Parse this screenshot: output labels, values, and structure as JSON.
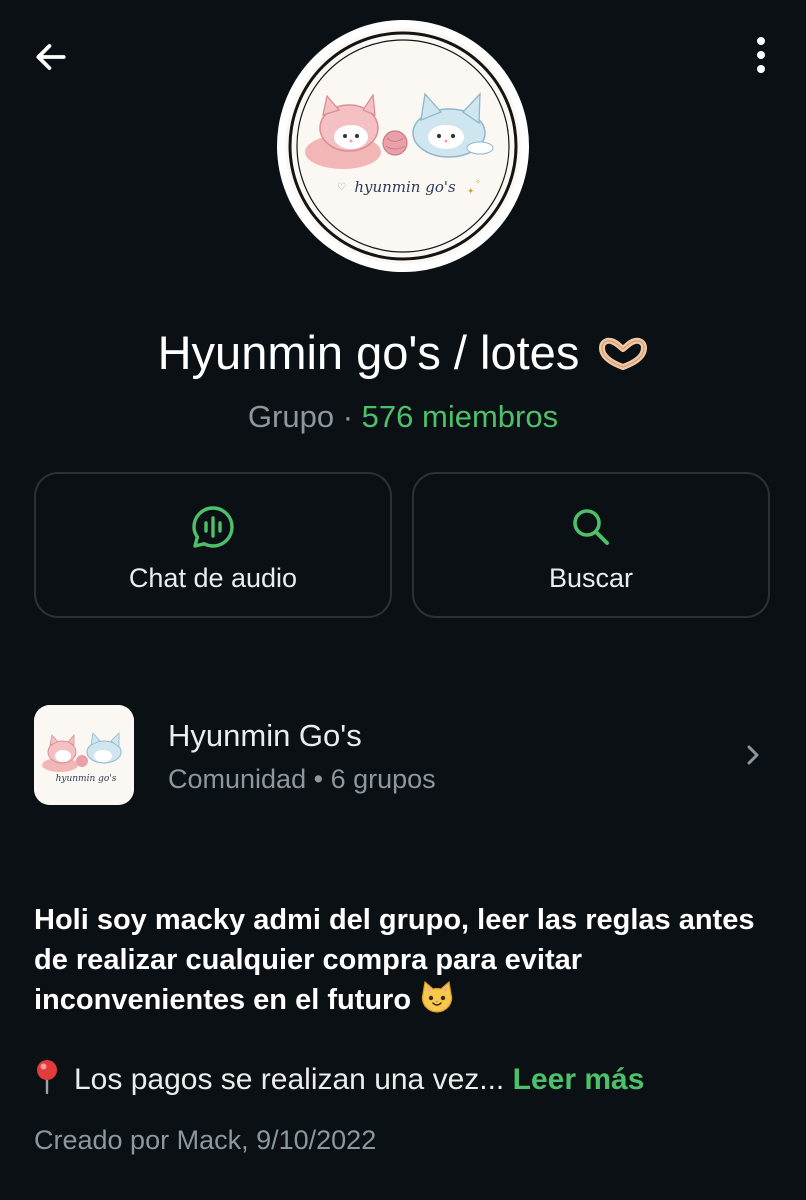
{
  "header": {
    "back_icon": "arrow-left-icon",
    "menu_icon": "more-vertical-icon"
  },
  "group": {
    "avatar_logo_text": "hyunmin go's",
    "title": "Hyunmin go's / lotes",
    "title_emoji": "heart-hands-emoji",
    "type": "Grupo",
    "separator": "·",
    "members": "576 miembros"
  },
  "actions": [
    {
      "label": "Chat de audio",
      "icon": "audio-chat-icon"
    },
    {
      "label": "Buscar",
      "icon": "search-icon"
    }
  ],
  "community": {
    "name": "Hyunmin Go's",
    "type": "Comunidad",
    "separator": "•",
    "groups": "6 grupos",
    "icon": "chevron-right-icon"
  },
  "description": {
    "text": "Holi soy macky admi del grupo, leer las reglas antes de realizar cualquier compra para evitar inconvenientes en el futuro",
    "emoji": "cat-emoji",
    "pin_emoji": "round-pushpin-emoji",
    "pin_text": "Los pagos se realizan una vez...",
    "read_more": "Leer más"
  },
  "created": "Creado por Mack, 9/10/2022",
  "colors": {
    "background": "#0b1014",
    "accent": "#4ec06a",
    "secondary_text": "#8d979e",
    "card_border": "#2a3238"
  }
}
